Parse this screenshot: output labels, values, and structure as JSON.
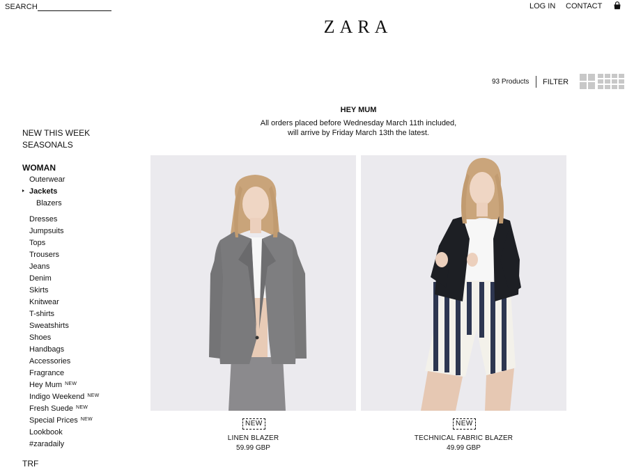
{
  "header": {
    "search_label": "SEARCH",
    "search_value": "",
    "login_label": "LOG IN",
    "contact_label": "CONTACT",
    "bag_icon": "shopping-bag-icon",
    "logo_text": "ZARA"
  },
  "toolbar": {
    "products_count": "93 Products",
    "filter_label": "FILTER",
    "grid_large_icon": "grid-large-view-icon",
    "grid_small_icon": "grid-small-view-icon"
  },
  "banner": {
    "title": "HEY MUM",
    "line1": "All orders placed before Wednesday March 11th included,",
    "line2": "will arrive by Friday March 13th the latest."
  },
  "sidebar": {
    "top_items": [
      "NEW THIS WEEK",
      "SEASONALS"
    ],
    "section_title": "WOMAN",
    "items": [
      {
        "label": "Outerwear"
      },
      {
        "label": "Jackets",
        "active": true
      },
      {
        "label": "Blazers",
        "level": 2
      },
      {
        "label": "Dresses"
      },
      {
        "label": "Jumpsuits"
      },
      {
        "label": "Tops"
      },
      {
        "label": "Trousers"
      },
      {
        "label": "Jeans"
      },
      {
        "label": "Denim"
      },
      {
        "label": "Skirts"
      },
      {
        "label": "Knitwear"
      },
      {
        "label": "T-shirts"
      },
      {
        "label": "Sweatshirts"
      },
      {
        "label": "Shoes"
      },
      {
        "label": "Handbags"
      },
      {
        "label": "Accessories"
      },
      {
        "label": "Fragrance"
      },
      {
        "label": "Hey Mum",
        "tag": "NEW"
      },
      {
        "label": "Indigo Weekend",
        "tag": "NEW"
      },
      {
        "label": "Fresh Suede",
        "tag": "NEW"
      },
      {
        "label": "Special Prices",
        "tag": "NEW"
      },
      {
        "label": "Lookbook"
      },
      {
        "label": "#zaradaily"
      }
    ],
    "bottom_item": "TRF"
  },
  "products": [
    {
      "badge": "NEW",
      "name": "LINEN BLAZER",
      "price": "59.99 GBP"
    },
    {
      "badge": "NEW",
      "name": "TECHNICAL FABRIC BLAZER",
      "price": "49.99 GBP"
    }
  ],
  "colors": {
    "text": "#111111",
    "image_background": "#ebeaee",
    "grid_icon": "#c8c8c8",
    "blazer_grey": "#7a7a7c",
    "blazer_black": "#1d1f24"
  }
}
